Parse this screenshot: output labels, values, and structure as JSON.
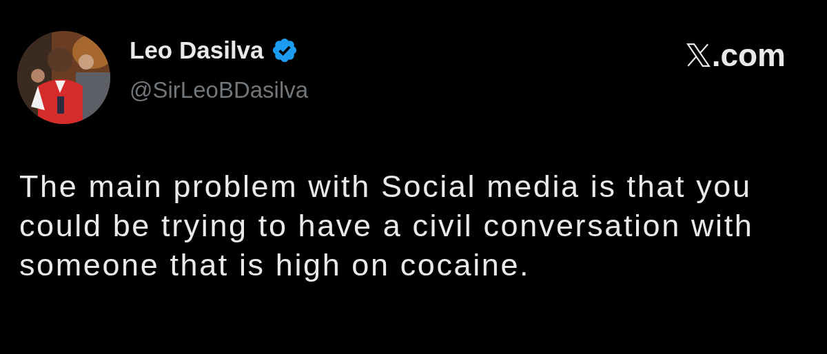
{
  "author": {
    "name": "Leo Dasilva",
    "verified": true,
    "handle": "@SirLeoBDasilva"
  },
  "site": {
    "label": ".com"
  },
  "post": {
    "text": "The main problem with Social media is that you could be trying to have a civil conversation with someone that is high on cocaine."
  }
}
